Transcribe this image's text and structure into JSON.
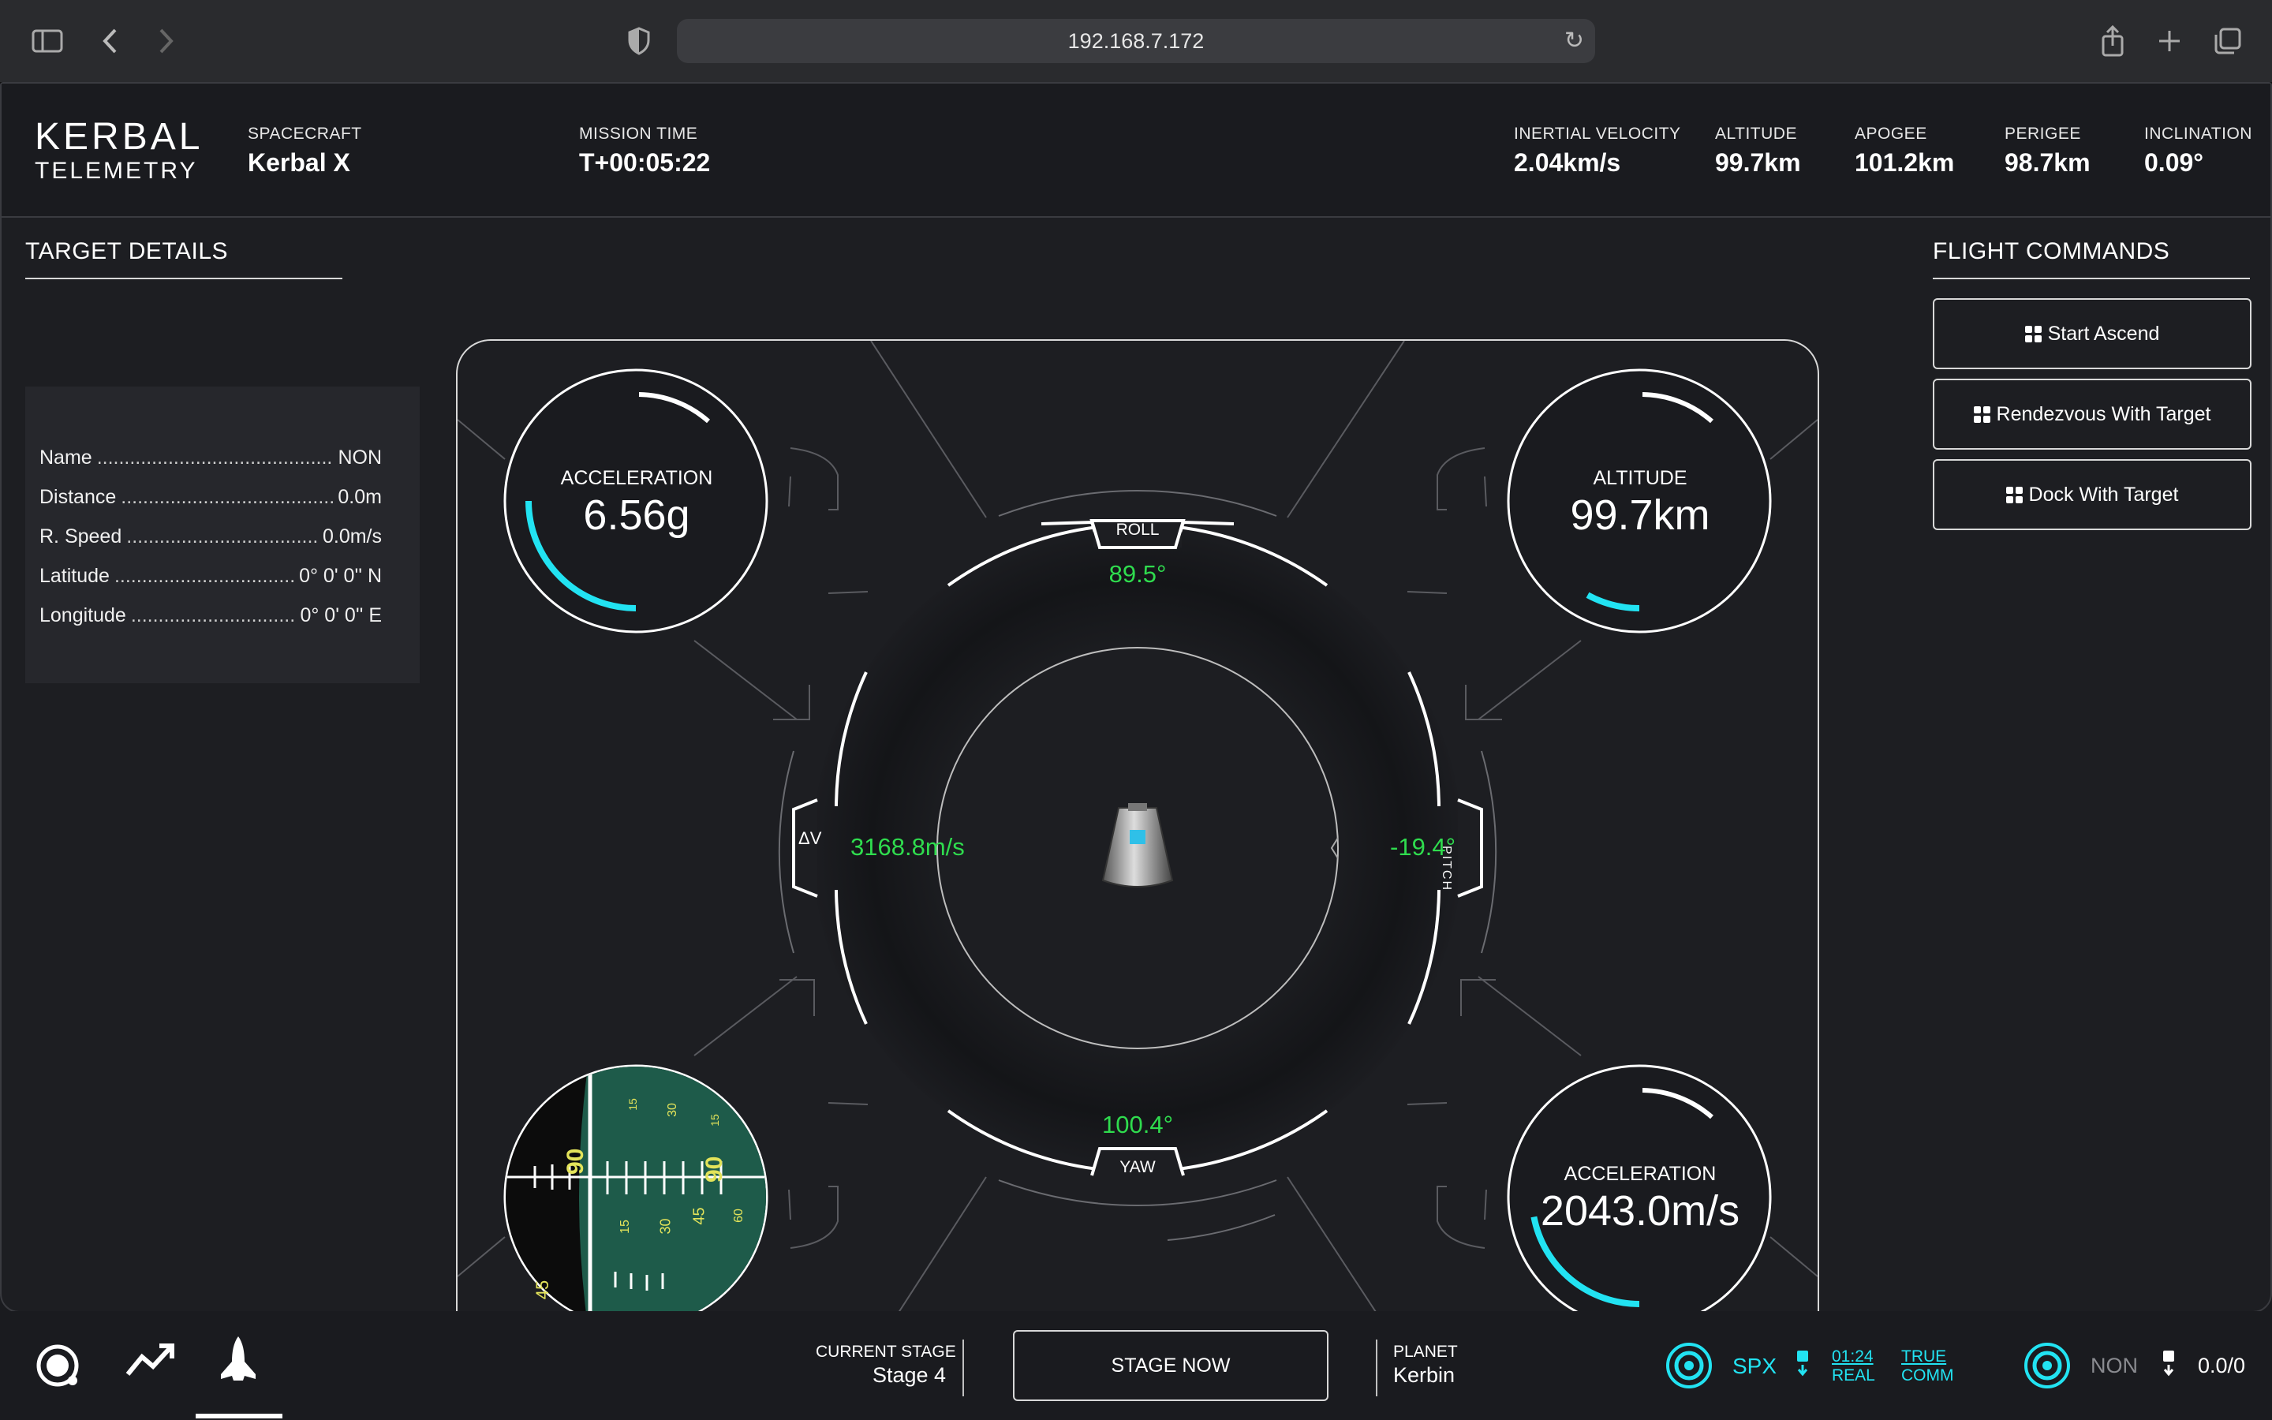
{
  "browser": {
    "url": "192.168.7.172"
  },
  "header": {
    "logo_line1": "KERBAL",
    "logo_line2": "TELEMETRY",
    "spacecraft_label": "SPACECRAFT",
    "spacecraft_value": "Kerbal X",
    "mission_time_label": "MISSION TIME",
    "mission_time_value": "T+00:05:22",
    "inertial_velocity_label": "INERTIAL VELOCITY",
    "inertial_velocity_value": "2.04km/s",
    "altitude_label": "ALTITUDE",
    "altitude_value": "99.7km",
    "apogee_label": "APOGEE",
    "apogee_value": "101.2km",
    "perigee_label": "PERIGEE",
    "perigee_value": "98.7km",
    "inclination_label": "INCLINATION",
    "inclination_value": "0.09°"
  },
  "target": {
    "title": "TARGET DETAILS",
    "rows": [
      {
        "label": "Name",
        "value": "NON"
      },
      {
        "label": "Distance",
        "value": "0.0m"
      },
      {
        "label": "R. Speed",
        "value": "0.0m/s"
      },
      {
        "label": "Latitude",
        "value": "0° 0' 0'' N"
      },
      {
        "label": "Longitude",
        "value": "0° 0' 0'' E"
      }
    ]
  },
  "commands": {
    "title": "FLIGHT COMMANDS",
    "buttons": [
      "Start Ascend",
      "Rendezvous With Target",
      "Dock With Target"
    ]
  },
  "hud": {
    "gauge_tl_label": "ACCELERATION",
    "gauge_tl_value": "6.56g",
    "gauge_tl_fraction": 0.25,
    "gauge_tr_label": "ALTITUDE",
    "gauge_tr_value": "99.7km",
    "gauge_tr_fraction": 0.08,
    "gauge_br_label": "ACCELERATION",
    "gauge_br_value": "2043.0m/s",
    "gauge_br_fraction": 0.22,
    "roll_label": "ROLL",
    "roll_value": "89.5°",
    "yaw_label": "YAW",
    "yaw_value": "100.4°",
    "pitch_label": "PITCH",
    "pitch_value": "-19.4°",
    "dv_label": "ΔV",
    "dv_value": "3168.8m/s",
    "navball_ticks": [
      "90",
      "90",
      "45",
      "30",
      "15",
      "45",
      "60",
      "30",
      "15",
      "15"
    ]
  },
  "colors": {
    "accent_cyan": "#22e3f2",
    "hud_green": "#2fdc4e",
    "navball_green": "#1e5b4a",
    "navball_yellow": "#e3e35a"
  },
  "footer": {
    "nav_icons": [
      "orbit-icon",
      "trend-icon",
      "shuttle-icon"
    ],
    "current_stage_label": "CURRENT STAGE",
    "current_stage_value": "Stage 4",
    "stage_button": "STAGE NOW",
    "planet_label": "PLANET",
    "planet_value": "Kerbin",
    "spx_label": "SPX",
    "time_value": "01:24",
    "time_mode": "REAL",
    "comm_line1": "TRUE",
    "comm_line2": "COMM",
    "target_name": "NON",
    "ratio_value": "0.0/0"
  }
}
